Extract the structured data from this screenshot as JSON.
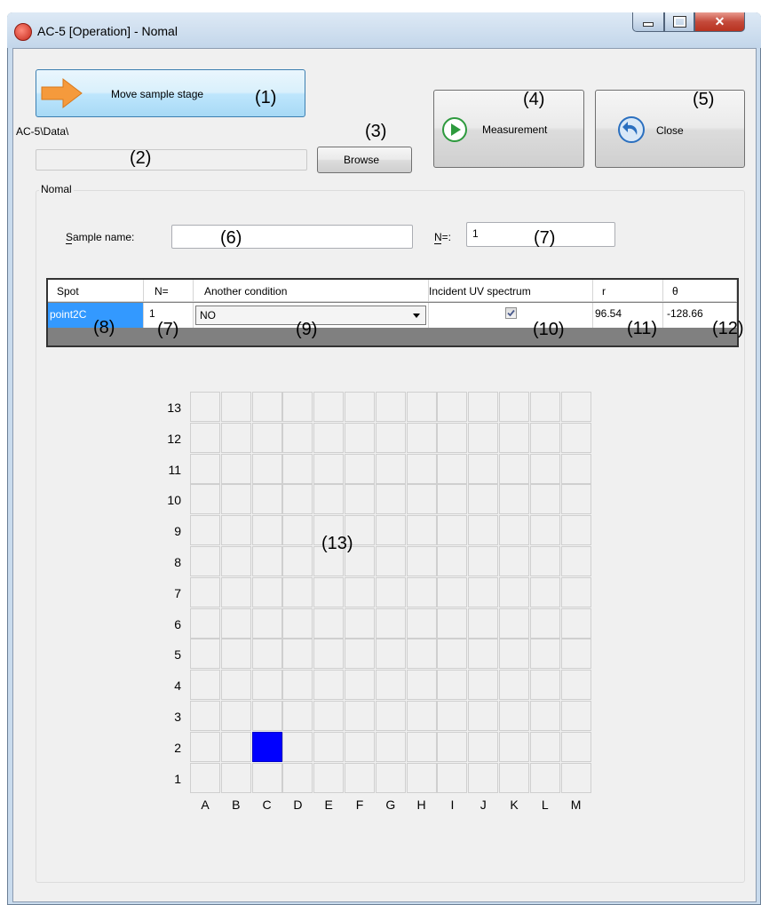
{
  "window": {
    "title": "AC-5 [Operation] - Nomal"
  },
  "toolbar": {
    "move_label": "Move sample stage",
    "measurement_label": "Measurement",
    "close_label": "Close",
    "browse_label": "Browse",
    "data_path": "AC-5\\Data\\"
  },
  "callouts": {
    "c1": "(1)",
    "c2": "(2)",
    "c3": "(3)",
    "c4": "(4)",
    "c5": "(5)",
    "c6": "(6)",
    "c7a": "(7)",
    "c7b": "(7)",
    "c8": "(8)",
    "c9": "(9)",
    "c10": "(10)",
    "c11": "(11)",
    "c12": "(12)",
    "c13": "(13)"
  },
  "group": {
    "title": "Nomal",
    "sample_name_label": "Sample name:",
    "sample_name_value": "",
    "n_label": "N=:",
    "n_value": "1"
  },
  "table": {
    "headers": [
      "Spot",
      "N=",
      "Another condition",
      "Incident UV spectrum",
      "r",
      "θ"
    ],
    "row": {
      "spot": "point2C",
      "n": "1",
      "condition": "NO",
      "uv_checked": true,
      "r": "96.54",
      "theta": "-128.66"
    }
  },
  "spot_grid": {
    "rows": [
      "13",
      "12",
      "11",
      "10",
      "9",
      "8",
      "7",
      "6",
      "5",
      "4",
      "3",
      "2",
      "1"
    ],
    "columns": [
      "A",
      "B",
      "C",
      "D",
      "E",
      "F",
      "G",
      "H",
      "I",
      "J",
      "K",
      "L",
      "M"
    ],
    "selected_cell": {
      "row": "2",
      "column": "C"
    },
    "selected_color": "#0000ff"
  },
  "colors": {
    "selection": "#3399ff",
    "accent_green": "#2e9a3e",
    "accent_blue": "#2a6fbf",
    "arrow_orange": "#f59a3c"
  }
}
